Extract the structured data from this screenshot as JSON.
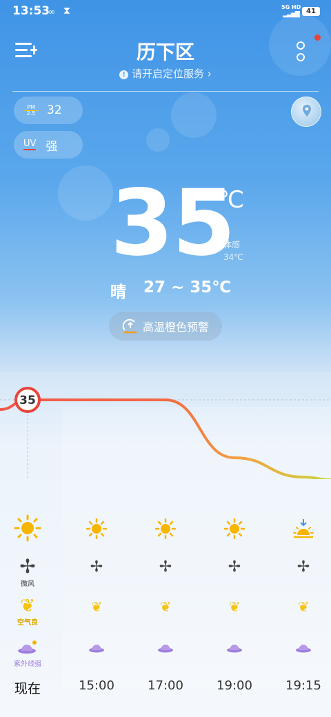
{
  "status_bar": {
    "time": "13:53",
    "net": "5G HD",
    "battery": "41"
  },
  "header": {
    "city": "历下区",
    "location_service": "请开启定位服务"
  },
  "pm": {
    "label_top": "PM",
    "label_bottom": "2.5",
    "value": "32"
  },
  "uv": {
    "label": "UV",
    "value": "强"
  },
  "current": {
    "temp": "35",
    "unit": "℃",
    "feels_label": "体感",
    "feels_value": "34℃",
    "condition": "晴",
    "range": "27 ~ 35℃",
    "alert": "高温橙色预警"
  },
  "chart_data": {
    "type": "line",
    "x": [
      "现在",
      "15:00",
      "17:00",
      "19:00",
      "19:15"
    ],
    "series": [
      {
        "values": [
          35,
          35,
          35,
          32,
          31
        ]
      }
    ],
    "current_label": "35"
  },
  "hourly": {
    "times": [
      "现在",
      "15:00",
      "17:00",
      "19:00",
      "19:15"
    ],
    "weather_icons": [
      "sun-icon",
      "sun-icon",
      "sun-icon",
      "sun-icon",
      "sunset-icon"
    ],
    "wind_label": "微风",
    "aqi_label": "空气良",
    "uv_label": "紫外线强"
  },
  "colors": {
    "accent_red": "#e8443a",
    "temp_line_start": "#f0584a",
    "temp_line_end": "#c9d63c",
    "sun": "#f7b500",
    "leaf": "#f5c20e",
    "uv_purple": "#9f7fdc"
  }
}
